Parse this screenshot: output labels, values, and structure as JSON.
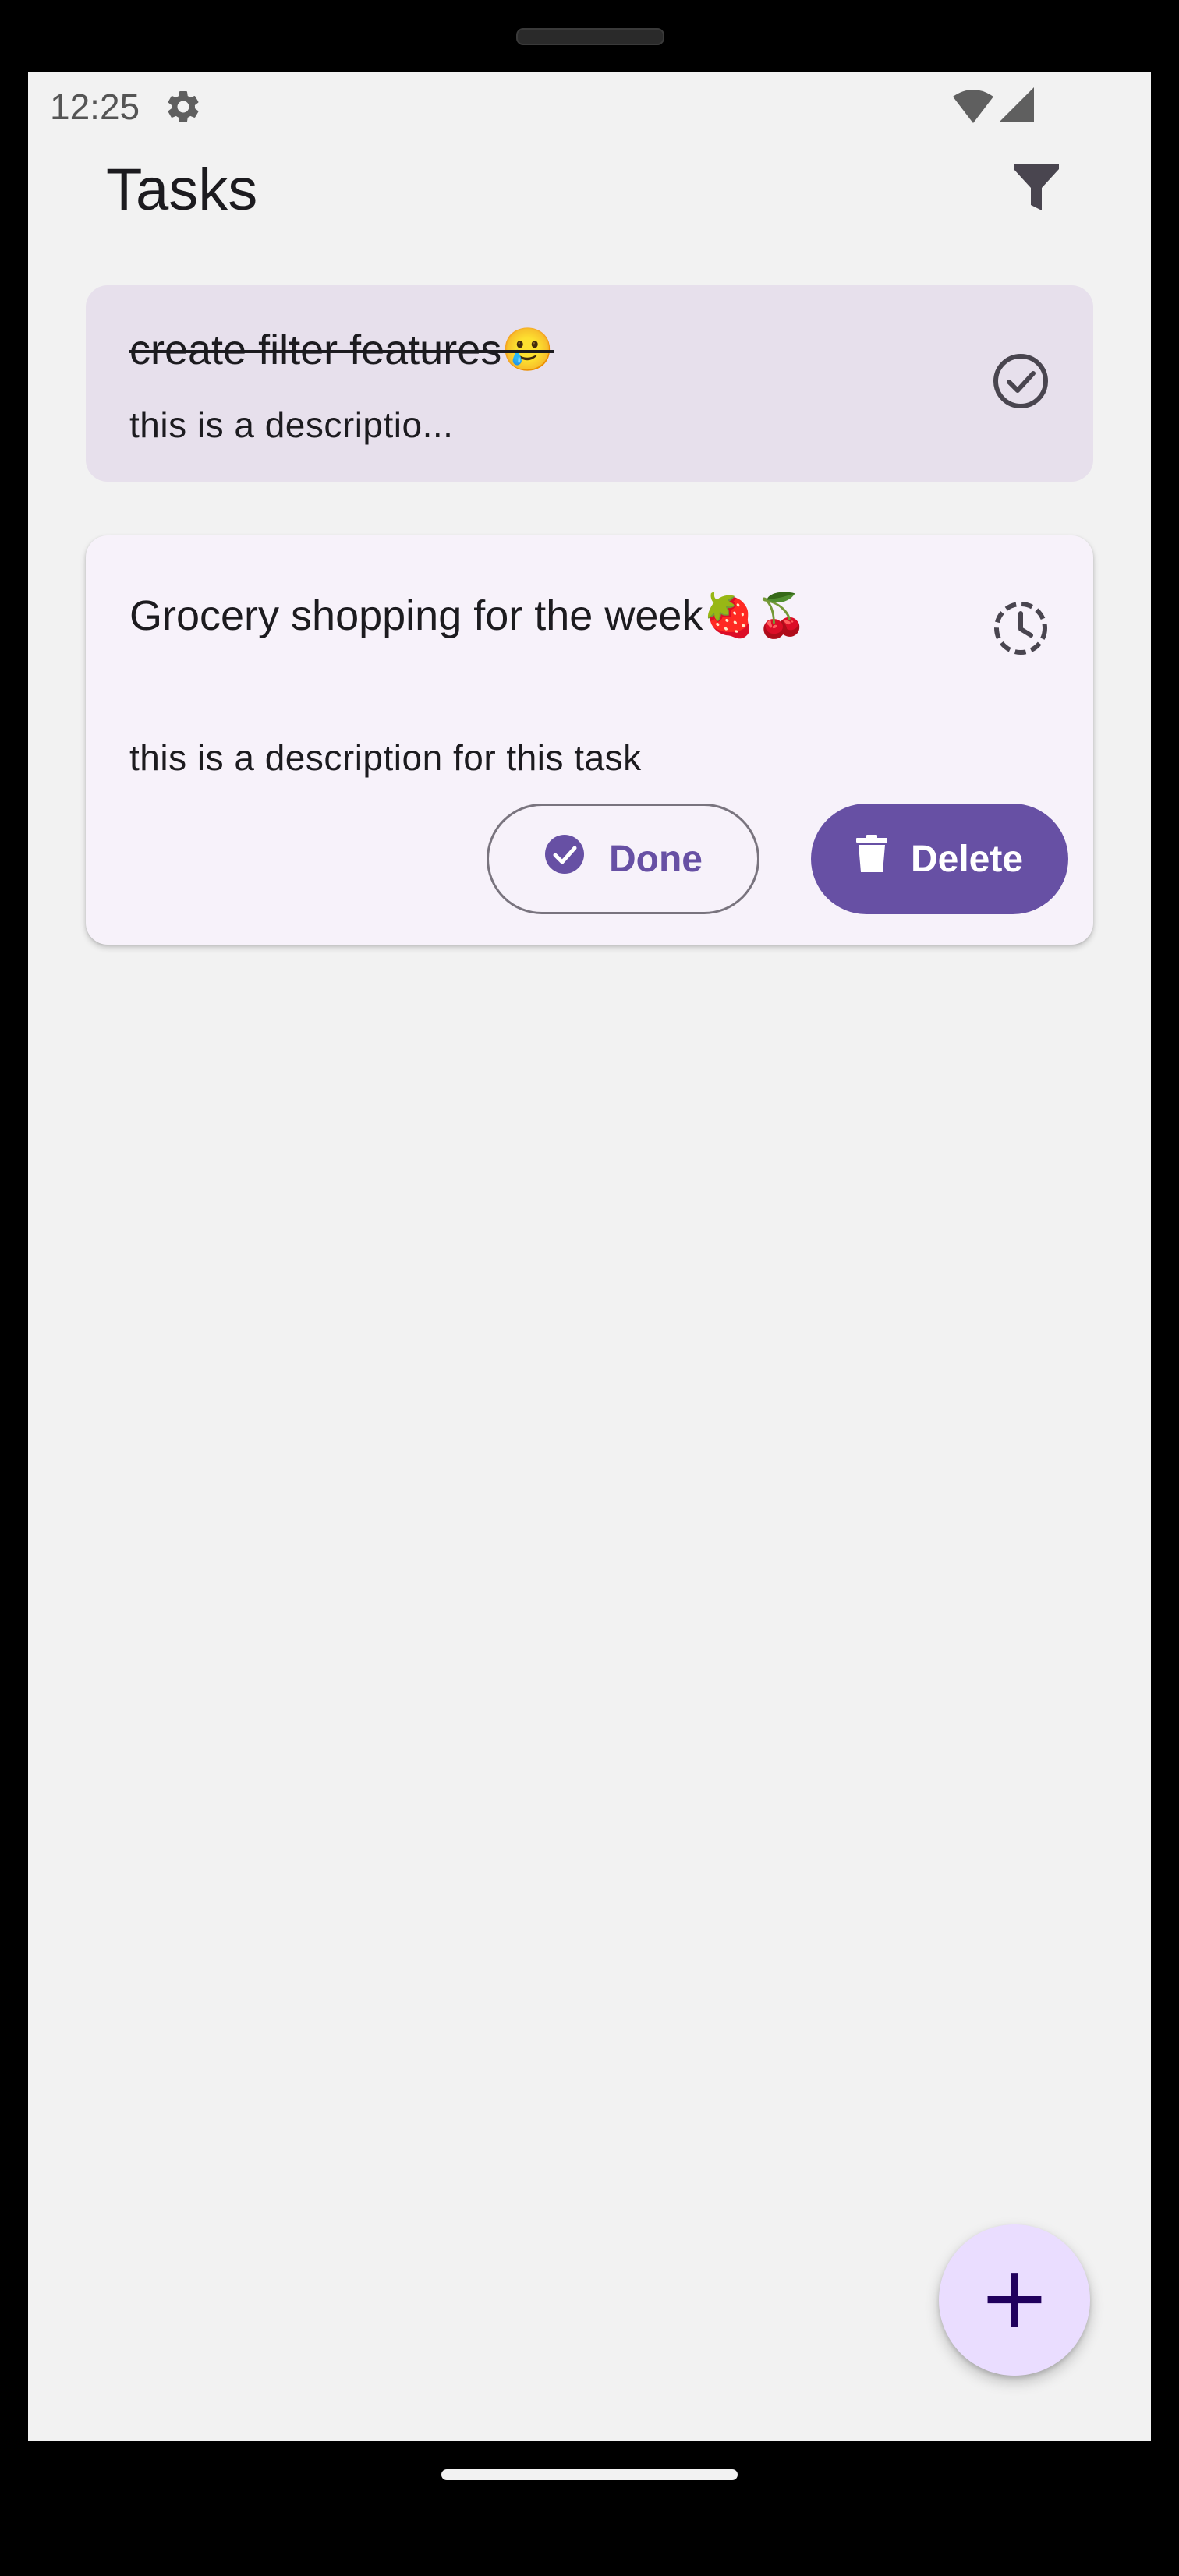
{
  "status_bar": {
    "time": "12:25",
    "icons": [
      "gear-icon",
      "wifi-icon",
      "cellular-signal-icon"
    ]
  },
  "app_bar": {
    "title": "Tasks",
    "filter_icon": "filter-icon"
  },
  "tasks": [
    {
      "title": "create filter features🥲",
      "description": "this is a descriptio...",
      "completed": true,
      "status_icon": "check-circle-icon",
      "expanded": false
    },
    {
      "title": "Grocery shopping for the week🍓🍒",
      "description": "this is a description for this task",
      "completed": false,
      "status_icon": "pending-clock-icon",
      "expanded": true,
      "actions": {
        "done_label": "Done",
        "done_icon": "check-circle-filled-icon",
        "delete_label": "Delete",
        "delete_icon": "trash-icon"
      }
    }
  ],
  "fab": {
    "label": "+",
    "icon": "add-icon"
  },
  "colors": {
    "background": "#f2f2f2",
    "primary": "#6750a4",
    "done_card": "#e7e0ec",
    "active_card": "#f7f2fa",
    "fab": "#eaddff"
  }
}
